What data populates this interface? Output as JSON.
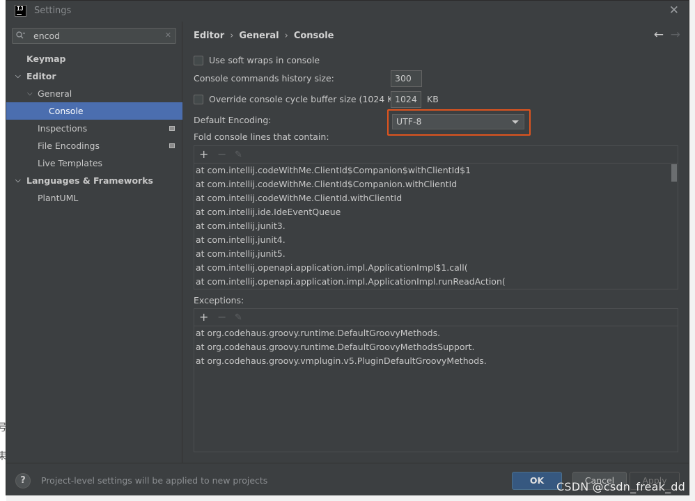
{
  "window": {
    "title": "Settings",
    "close_glyph": "✕"
  },
  "search": {
    "value": "encod",
    "placeholder": ""
  },
  "sidebar": {
    "items": [
      {
        "label": "Keymap"
      },
      {
        "label": "Editor"
      },
      {
        "label": "General"
      },
      {
        "label": "Console"
      },
      {
        "label": "Inspections"
      },
      {
        "label": "File Encodings"
      },
      {
        "label": "Live Templates"
      },
      {
        "label": "Languages & Frameworks"
      },
      {
        "label": "PlantUML"
      }
    ]
  },
  "breadcrumb": {
    "parts": [
      "Editor",
      "General",
      "Console"
    ],
    "separator": "›"
  },
  "nav": {
    "back": "←",
    "forward": "→"
  },
  "settings": {
    "soft_wraps_label": "Use soft wraps in console",
    "history_label": "Console commands history size:",
    "history_value": "300",
    "override_label": "Override console cycle buffer size (1024 KB)",
    "buffer_value": "1024",
    "buffer_unit": "KB",
    "encoding_label": "Default Encoding:",
    "encoding_value": "UTF-8",
    "fold_label": "Fold console lines that contain:",
    "exceptions_label": "Exceptions:"
  },
  "toolbar": {
    "add": "+",
    "remove": "−",
    "edit": "✎"
  },
  "fold_lines": [
    "at com.intellij.codeWithMe.ClientId$Companion$withClientId$1",
    "at com.intellij.codeWithMe.ClientId$Companion.withClientId",
    "at com.intellij.codeWithMe.ClientId.withClientId",
    "at com.intellij.ide.IdeEventQueue",
    "at com.intellij.junit3.",
    "at com.intellij.junit4.",
    "at com.intellij.junit5.",
    "at com.intellij.openapi.application.impl.ApplicationImpl$1.call(",
    "at com.intellij.openapi.application.impl.ApplicationImpl.runReadAction("
  ],
  "exceptions": [
    "at org.codehaus.groovy.runtime.DefaultGroovyMethods.",
    "at org.codehaus.groovy.runtime.DefaultGroovyMethodsSupport.",
    "at org.codehaus.groovy.vmplugin.v5.PluginDefaultGroovyMethods."
  ],
  "footer": {
    "help": "?",
    "note": "Project-level settings will be applied to new projects",
    "ok": "OK",
    "cancel": "Cancel",
    "apply": "Apply"
  },
  "watermark": "CSDN @csdn_freak_dd",
  "colors": {
    "accent": "#4b6eaf",
    "highlight": "#e0541e",
    "ok_button": "#365880",
    "background": "#3c3f41"
  }
}
